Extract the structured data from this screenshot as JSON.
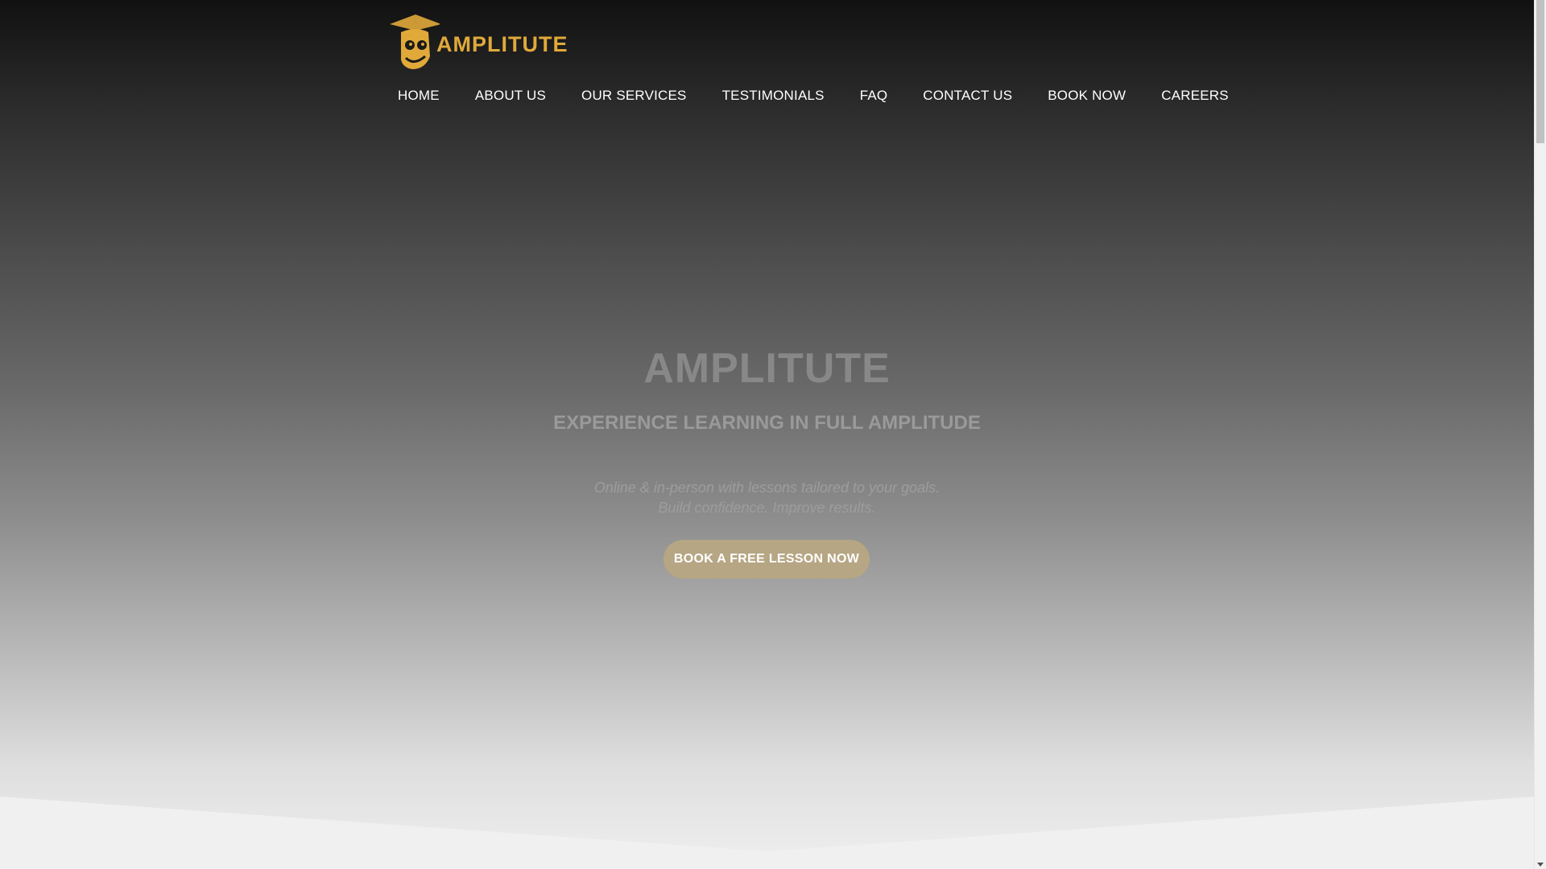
{
  "brand": {
    "name": "AMPLITUTE",
    "accent_color": "#e0a93a",
    "logo_icon": "owl-graduation-cap-icon"
  },
  "nav": {
    "items": [
      {
        "label": "HOME"
      },
      {
        "label": "ABOUT US"
      },
      {
        "label": "OUR SERVICES"
      },
      {
        "label": "TESTIMONIALS"
      },
      {
        "label": "FAQ"
      },
      {
        "label": "CONTACT US"
      },
      {
        "label": "BOOK NOW"
      },
      {
        "label": "CAREERS"
      }
    ]
  },
  "hero": {
    "title": "AMPLITUTE",
    "subtitle": "EXPERIENCE LEARNING IN FULL AMPLITUDE",
    "description_line1": "Online & in-person with lessons tailored to your goals.",
    "description_line2": "Build confidence. Improve results.",
    "cta_label": "BOOK A FREE LESSON NOW",
    "cta_color": "#b6a684"
  }
}
